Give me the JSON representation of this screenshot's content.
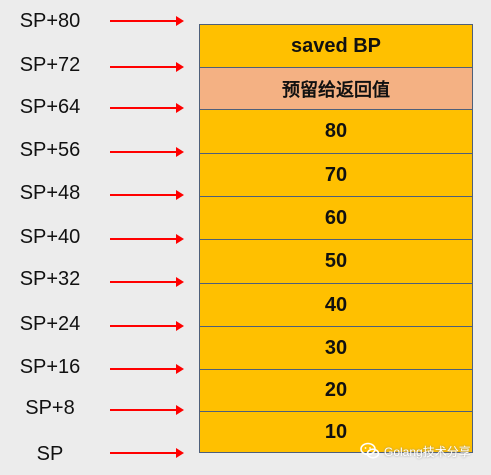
{
  "sp_labels": [
    "SP+80",
    "SP+72",
    "SP+64",
    "SP+56",
    "SP+48",
    "SP+40",
    "SP+32",
    "SP+24",
    "SP+16",
    "SP+8",
    "SP"
  ],
  "stack_cells": [
    {
      "text": "saved BP",
      "kind": "normal"
    },
    {
      "text": "预留给返回值",
      "kind": "reserved"
    },
    {
      "text": "80",
      "kind": "normal"
    },
    {
      "text": "70",
      "kind": "normal"
    },
    {
      "text": "60",
      "kind": "normal"
    },
    {
      "text": "50",
      "kind": "normal"
    },
    {
      "text": "40",
      "kind": "normal"
    },
    {
      "text": "30",
      "kind": "normal"
    },
    {
      "text": "20",
      "kind": "normal"
    },
    {
      "text": "10",
      "kind": "normal"
    }
  ],
  "colors": {
    "cell": "#ffc000",
    "reserved_cell": "#f4b183",
    "arrow": "#ff0000",
    "cell_border": "#4e5f7a"
  },
  "watermark": {
    "icon": "wechat-icon",
    "text": "Golang技术分享"
  }
}
